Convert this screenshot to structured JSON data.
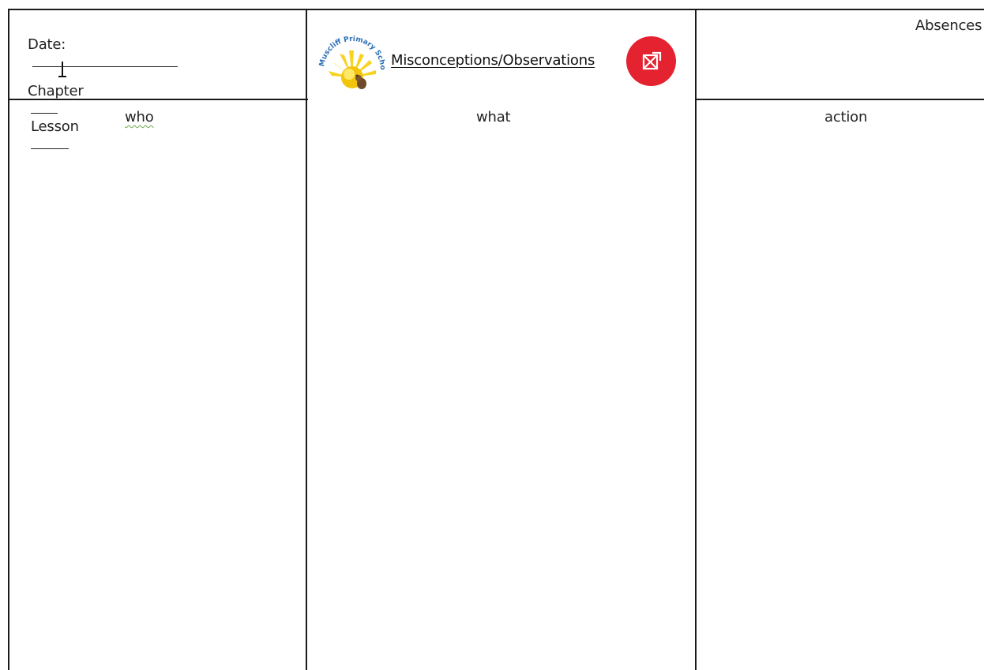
{
  "header": {
    "date_label": "Date:",
    "chapter_label": "Chapter",
    "lesson_label": "Lesson",
    "title": "Misconceptions/Observations",
    "absences_label": "Absences",
    "logo_text": "Muscliff Primary School"
  },
  "columns": {
    "who": "who",
    "what": "what",
    "action": "action"
  },
  "icons": {
    "badge_icon": "expand-x-icon",
    "badge_color": "#e5222f",
    "cursor": "text-cursor-icon"
  }
}
